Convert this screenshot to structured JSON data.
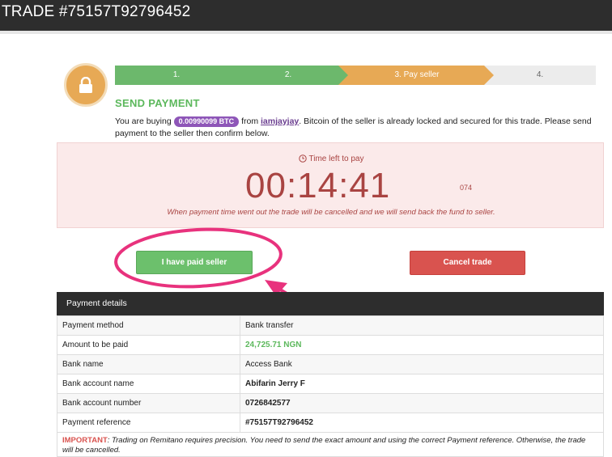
{
  "header": {
    "title": "TRADE #75157T92796452"
  },
  "progress": {
    "steps": [
      {
        "label": "1.",
        "status": "done"
      },
      {
        "label": "2.",
        "status": "done"
      },
      {
        "label": "3. Pay seller",
        "status": "current"
      },
      {
        "label": "4.",
        "status": "pending"
      }
    ]
  },
  "payment": {
    "title": "SEND PAYMENT",
    "intro_prefix": "You are buying",
    "btc_amount": "0.00990099 BTC",
    "from_text": "from",
    "seller": "iamjayjay",
    "intro_suffix": ". Bitcoin of the seller is already locked and secured for this trade. Please send payment to the seller then confirm below."
  },
  "timer": {
    "label": "Time left to pay",
    "countdown": "00:14:41",
    "millis": "074",
    "note": "When payment time went out the trade will be cancelled and we will send back the fund to seller."
  },
  "actions": {
    "paid": "I have paid seller",
    "cancel": "Cancel trade"
  },
  "details": {
    "title": "Payment details",
    "rows": [
      {
        "label": "Payment method",
        "value": "Bank transfer"
      },
      {
        "label": "Amount to be paid",
        "value": "24,725.71 NGN"
      },
      {
        "label": "Bank name",
        "value": "Access Bank"
      },
      {
        "label": "Bank account name",
        "value": "Abifarin Jerry F"
      },
      {
        "label": "Bank account number",
        "value": "0726842577"
      },
      {
        "label": "Payment reference",
        "value": "#75157T92796452"
      }
    ]
  },
  "important": {
    "label": "IMPORTANT",
    "text": ": Trading on Remitano requires precision. You need to send the exact amount and using the correct Payment reference. Otherwise, the trade will be cancelled."
  },
  "colors": {
    "done": "#6cb86c",
    "current": "#e7a955",
    "pending": "#ececec",
    "danger": "#a94442",
    "annotation": "#e8327d"
  }
}
